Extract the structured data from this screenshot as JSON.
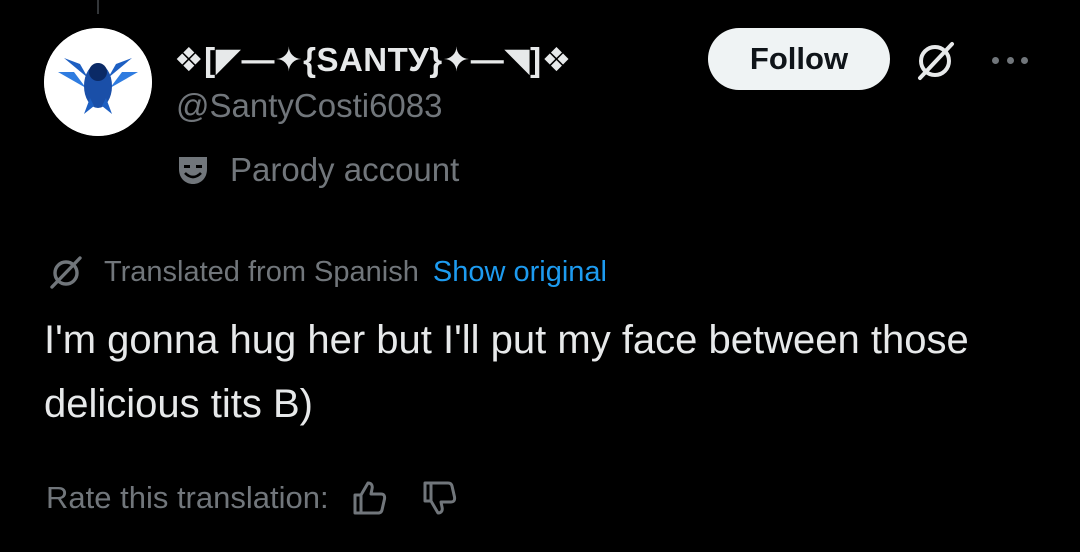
{
  "post": {
    "author": {
      "display_name": "❖[◤—✦{SANTУ}✦—◥]❖",
      "handle": "@SantyCosti6083",
      "parody_label": "Parody account",
      "avatar_icon": "blue-winged-emblem-icon"
    },
    "follow_label": "Follow",
    "translation": {
      "notice": "Translated from Spanish",
      "show_original": "Show original"
    },
    "body": "I'm gonna hug her but I'll put my face between those delicious tits B)",
    "rating": {
      "label": "Rate this translation:",
      "icons": [
        "thumbs-up-icon",
        "thumbs-down-icon"
      ]
    }
  },
  "colors": {
    "background": "#000000",
    "primary_text": "#e7e9ea",
    "secondary_text": "#71767b",
    "link": "#1d9bf0",
    "follow_bg": "#eff3f4",
    "avatar_blue": "#1d5fc2"
  }
}
